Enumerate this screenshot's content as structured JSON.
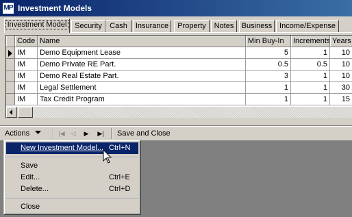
{
  "window": {
    "icon_text": "MP",
    "title": "Investment Models"
  },
  "tabs": [
    "Investment Model",
    "Security",
    "Cash",
    "Insurance",
    "Property",
    "Notes",
    "Business",
    "Income/Expense"
  ],
  "grid": {
    "columns": [
      "Code",
      "Name",
      "Min Buy-In",
      "Increments",
      "Years"
    ],
    "rows": [
      [
        "IM",
        "Demo Equipment Lease",
        "5",
        "1",
        "10"
      ],
      [
        "IM",
        "Demo Private RE Part.",
        "0.5",
        "0.5",
        "10"
      ],
      [
        "IM",
        "Demo Real Estate Part.",
        "3",
        "1",
        "10"
      ],
      [
        "IM",
        "Legal Settlement",
        "1",
        "1",
        "30"
      ],
      [
        "IM",
        "Tax Credit Program",
        "1",
        "1",
        "15"
      ]
    ],
    "current_row": 0
  },
  "toolbar": {
    "actions_label": "Actions",
    "save_close_label": "Save and Close"
  },
  "menu": {
    "items": [
      {
        "label": "New Investment Model...",
        "shortcut": "Ctrl+N",
        "highlighted": true
      },
      {
        "label": "Save",
        "shortcut": ""
      },
      {
        "label": "Edit...",
        "shortcut": "Ctrl+E"
      },
      {
        "label": "Delete...",
        "shortcut": "Ctrl+D"
      },
      {
        "label": "Close",
        "shortcut": ""
      }
    ]
  },
  "colors": {
    "title_bar": "#0a246a",
    "highlight": "#0a246a",
    "face": "#d4d0c8",
    "workspace": "#808080"
  }
}
